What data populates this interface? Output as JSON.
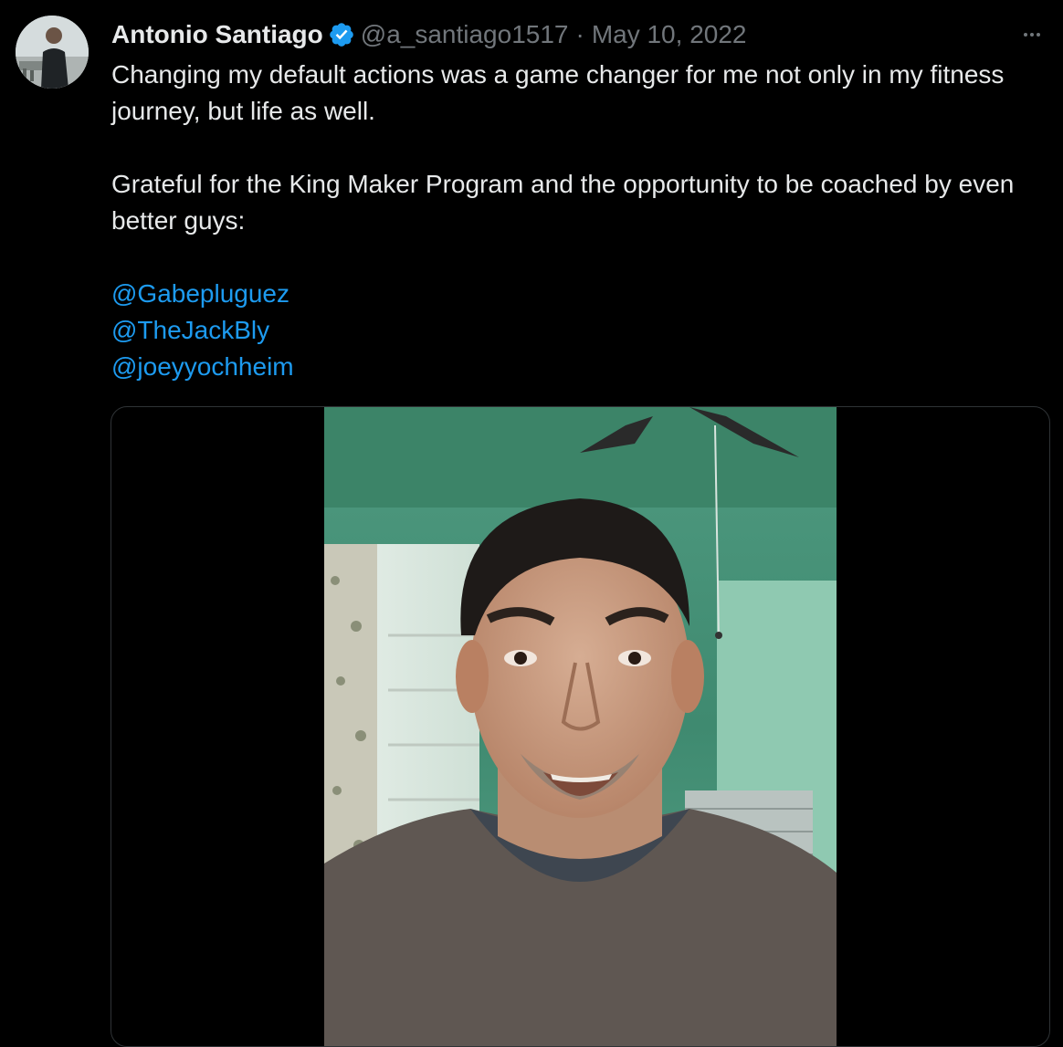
{
  "tweet": {
    "author_name": "Antonio Santiago",
    "handle": "@a_santiago1517",
    "separator": "·",
    "date": "May 10, 2022",
    "verified_icon": "verified-badge-icon",
    "more_icon": "more-options-icon",
    "paragraphs": [
      "Changing my default actions was a game changer for me not only in my fitness journey, but life as well.",
      "Grateful for the King Maker Program and the opportunity to be coached by even better guys:"
    ],
    "mentions": [
      "@Gabepluguez",
      "@TheJackBly",
      "@joeyyochheim"
    ]
  },
  "colors": {
    "background": "#000000",
    "text": "#e7e9ea",
    "secondary": "#71767b",
    "link": "#1d9bf0",
    "verified": "#1d9bf0"
  }
}
